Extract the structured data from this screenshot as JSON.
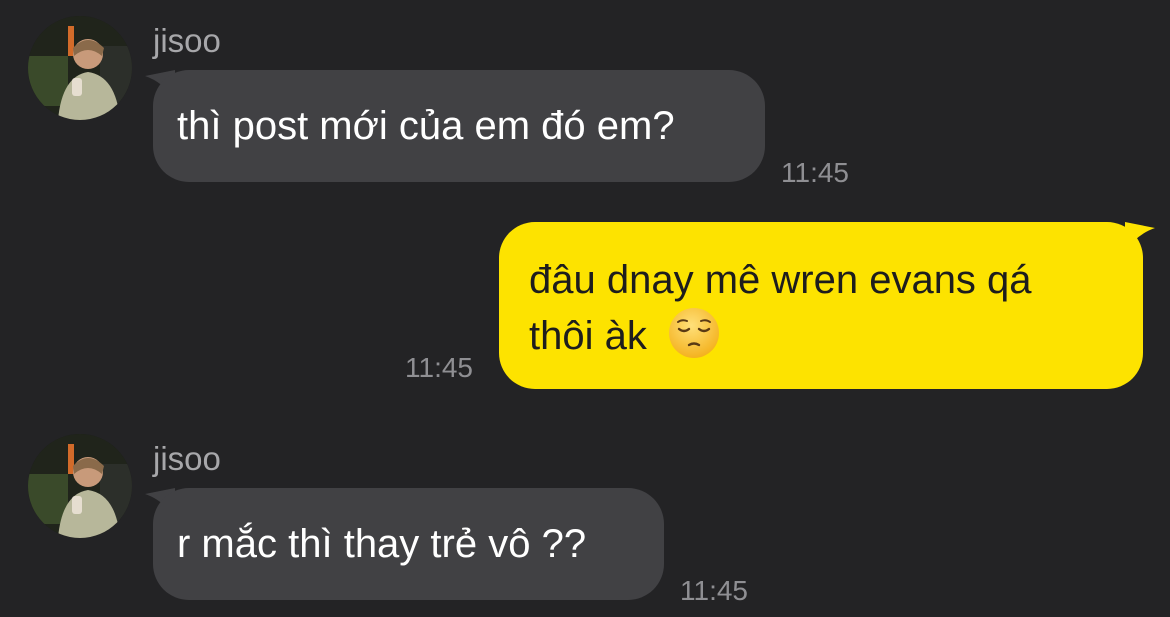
{
  "conversation": {
    "messages": [
      {
        "sender": "jisoo",
        "text": "thì post mới của em đó em?",
        "time": "11:45",
        "direction": "incoming"
      },
      {
        "sender": "",
        "line1": "đâu dnay mê wren evans qá",
        "line2": "thôi àk",
        "emoji": "pensive-face",
        "time": "11:45",
        "direction": "outgoing"
      },
      {
        "sender": "jisoo",
        "text": "r mắc thì thay trẻ vô ??",
        "time": "11:45",
        "direction": "incoming"
      }
    ]
  },
  "colors": {
    "background": "#232325",
    "incoming_bubble": "#414144",
    "outgoing_bubble": "#fde300"
  }
}
